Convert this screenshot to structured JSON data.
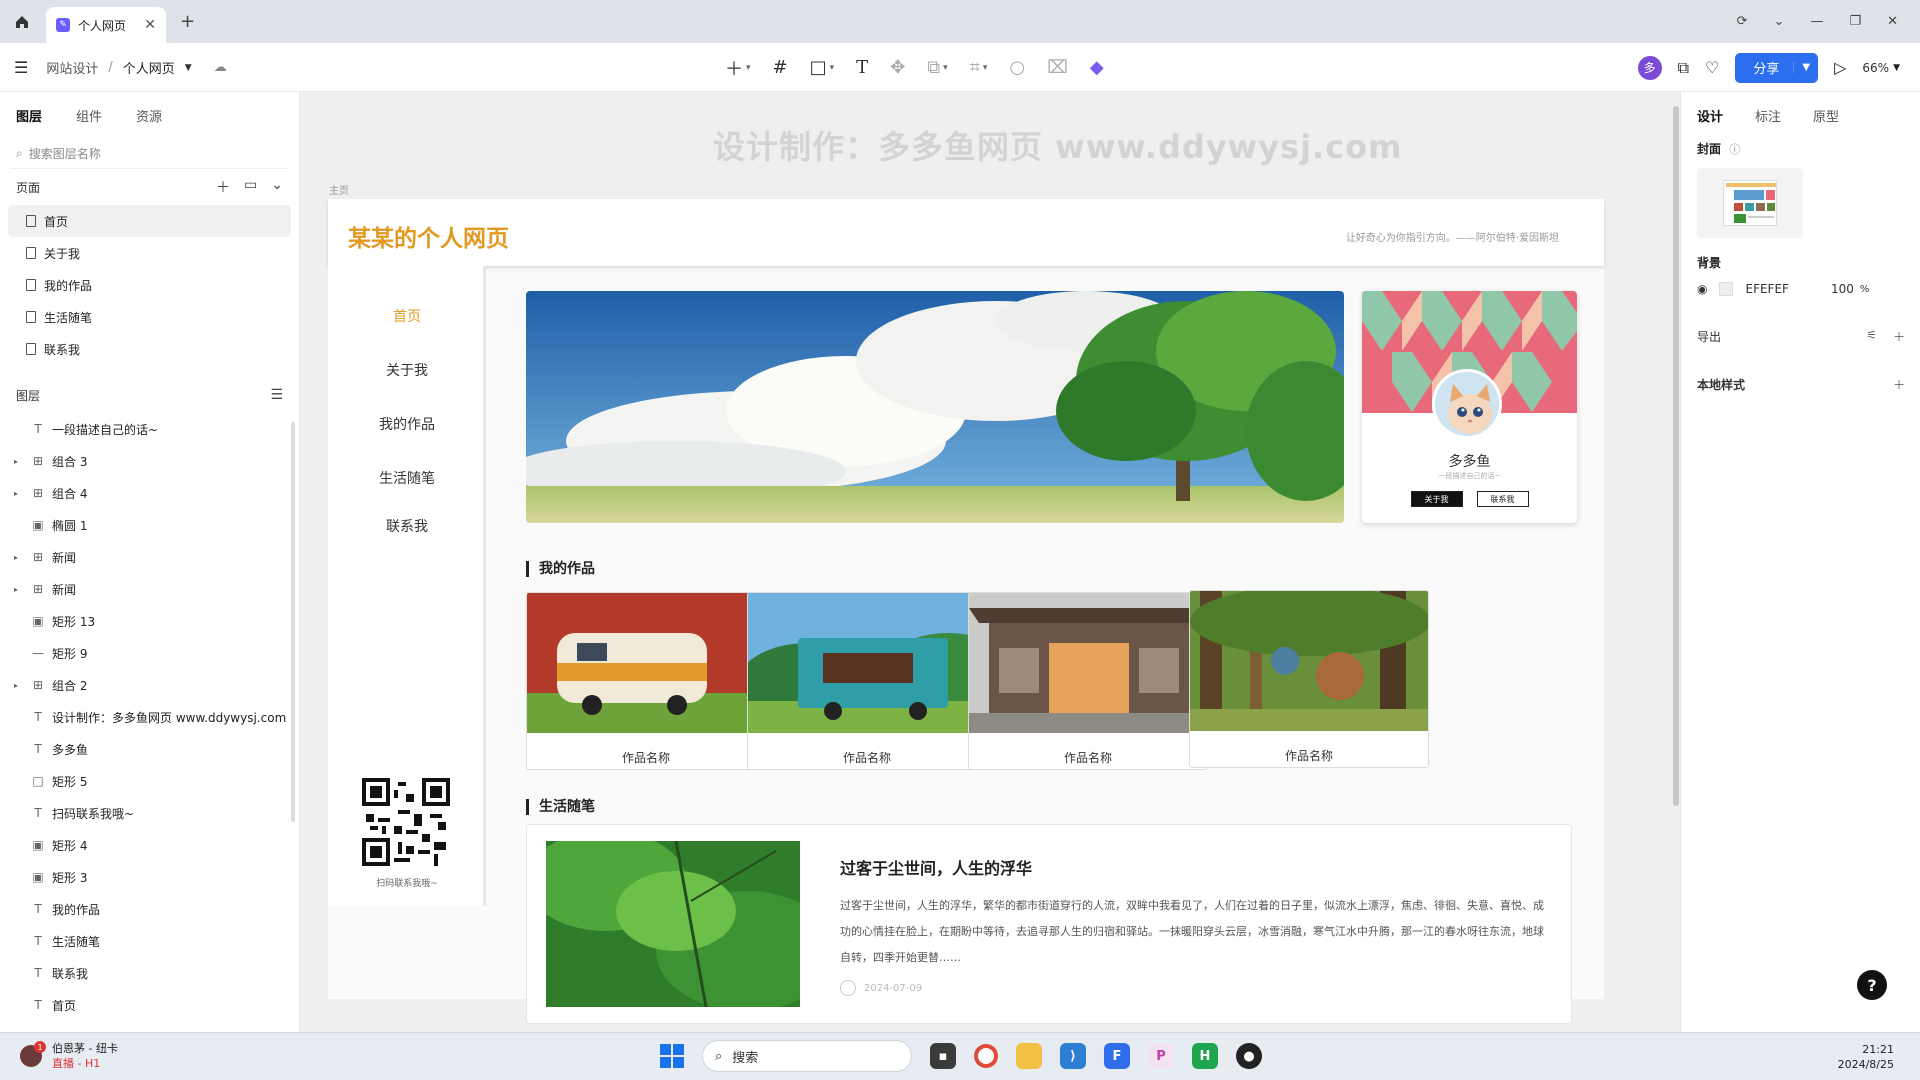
{
  "browser": {
    "tab_title": "个人网页",
    "tab_favicon": "pen-logo-icon"
  },
  "toolbar": {
    "breadcrumb_project": "网站设计",
    "breadcrumb_sep": "/",
    "breadcrumb_current": "个人网页",
    "avatar_letter": "多",
    "share_label": "分享",
    "zoom_label": "66%"
  },
  "left_panel": {
    "tabs": [
      "图层",
      "组件",
      "资源"
    ],
    "search_placeholder": "搜索图层名称",
    "pages_label": "页面",
    "pages": [
      "首页",
      "关于我",
      "我的作品",
      "生活随笔",
      "联系我"
    ],
    "layers_label": "图层",
    "layers": [
      {
        "icon": "text-icon",
        "label": "一段描述自己的话~",
        "group": false
      },
      {
        "icon": "group-icon",
        "label": "组合 3",
        "group": true
      },
      {
        "icon": "group-icon",
        "label": "组合 4",
        "group": true
      },
      {
        "icon": "image-icon",
        "label": "椭圆 1",
        "group": false
      },
      {
        "icon": "group-icon",
        "label": "新闻",
        "group": true
      },
      {
        "icon": "group-icon",
        "label": "新闻",
        "group": true
      },
      {
        "icon": "image-icon",
        "label": "矩形 13",
        "group": false
      },
      {
        "icon": "line-icon",
        "label": "矩形 9",
        "group": false
      },
      {
        "icon": "group-icon",
        "label": "组合 2",
        "group": true
      },
      {
        "icon": "text-icon",
        "label": "设计制作：多多鱼网页 www.ddywysj.com",
        "group": false
      },
      {
        "icon": "text-icon",
        "label": "多多鱼",
        "group": false
      },
      {
        "icon": "rect-icon",
        "label": "矩形 5",
        "group": false
      },
      {
        "icon": "text-icon",
        "label": "扫码联系我哦~",
        "group": false
      },
      {
        "icon": "image-icon",
        "label": "矩形 4",
        "group": false
      },
      {
        "icon": "image-icon",
        "label": "矩形 3",
        "group": false
      },
      {
        "icon": "text-icon",
        "label": "我的作品",
        "group": false
      },
      {
        "icon": "text-icon",
        "label": "生活随笔",
        "group": false
      },
      {
        "icon": "text-icon",
        "label": "联系我",
        "group": false
      },
      {
        "icon": "text-icon",
        "label": "首页",
        "group": false
      }
    ]
  },
  "canvas": {
    "watermark": "设计制作：多多鱼网页  www.ddywysj.com",
    "frame_label": "主页"
  },
  "site": {
    "title": "某某的个人网页",
    "quote": "让好奇心为你指引方向。——阿尔伯特·爱因斯坦",
    "nav": [
      "首页",
      "关于我",
      "我的作品",
      "生活随笔",
      "联系我"
    ],
    "qr_caption": "扫码联系我哦~",
    "profile": {
      "name": "多多鱼",
      "desc": "一段描述自己的话~",
      "btn_about": "关于我",
      "btn_contact": "联系我"
    },
    "works_title": "我的作品",
    "works": [
      "作品名称",
      "作品名称",
      "作品名称",
      "作品名称"
    ],
    "essays_title": "生活随笔",
    "essay": {
      "title": "过客于尘世间，人生的浮华",
      "body": "过客于尘世间，人生的浮华，繁华的都市街道穿行的人流，双眸中我看见了，人们在过着的日子里，似流水上漂浮，焦虑、徘徊、失意、喜悦、成功的心情挂在脸上，在期盼中等待，去追寻那人生的归宿和驿站。一抹暖阳穿头云层，冰雪消融，寒气江水中升腾，那一江的春水呀往东流，地球自转，四季开始更替……",
      "date": "2024-07-09"
    }
  },
  "right_panel": {
    "tabs": [
      "设计",
      "标注",
      "原型"
    ],
    "cover_label": "封面",
    "bg_label": "背景",
    "bg_hex": "EFEFEF",
    "bg_opacity": "100",
    "bg_percent": "%",
    "export_label": "导出",
    "local_styles_label": "本地样式"
  },
  "taskbar": {
    "notif_badge": "1",
    "notif_line1": "伯恩茅 - 纽卡",
    "notif_line2": "直播 - H1",
    "search_label": "搜索",
    "time": "21:21",
    "date": "2024/8/25"
  },
  "colors": {
    "accent_orange": "#e39a22",
    "share_blue": "#2b6ef0",
    "canvas_bg": "#efefef"
  }
}
